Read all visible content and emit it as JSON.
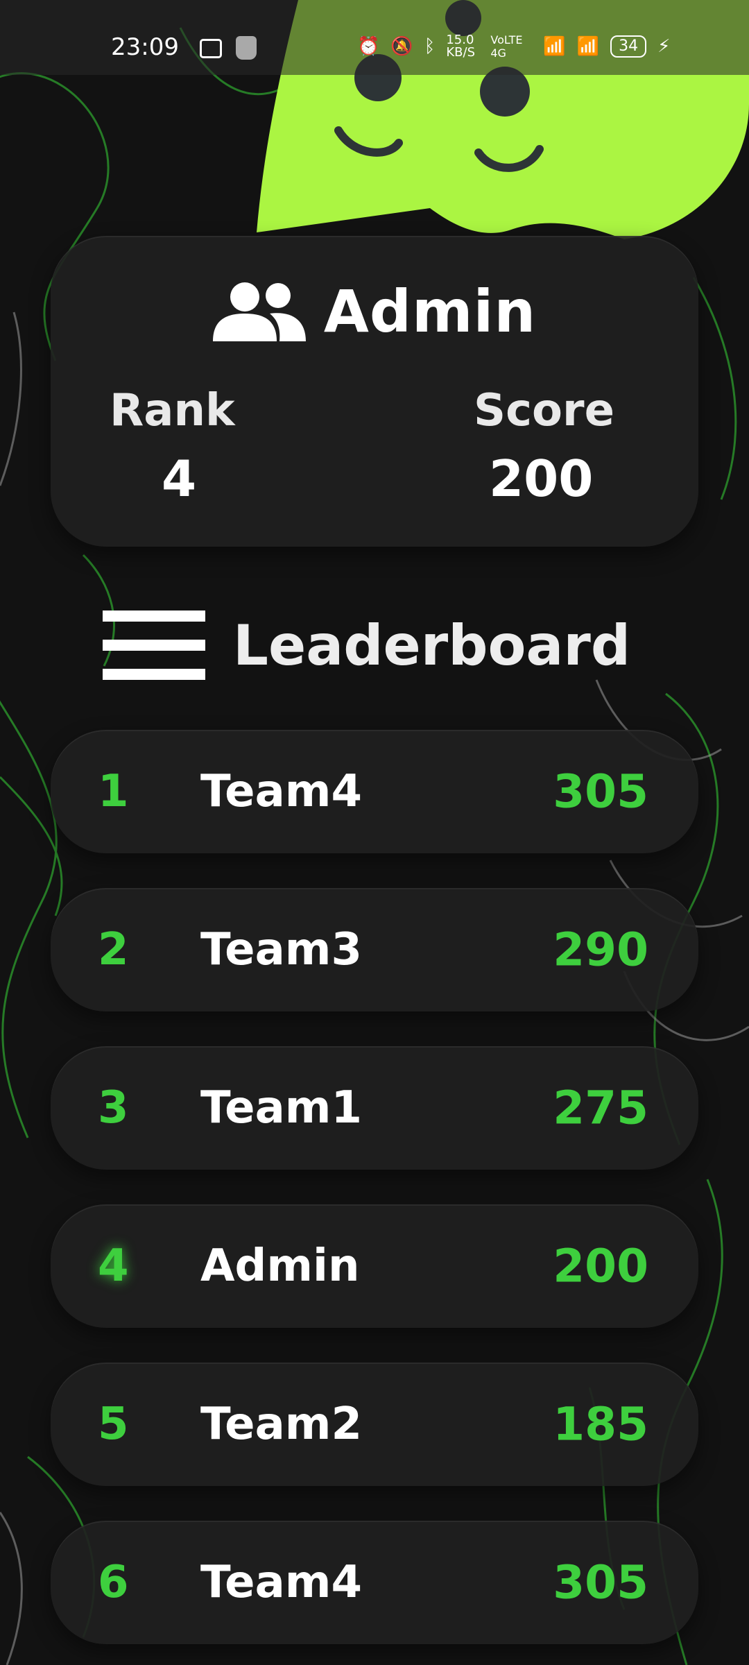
{
  "status_bar": {
    "time": "23:09",
    "net_speed": "15.0 KB/S",
    "network": "VoLTE 4G",
    "battery": "34"
  },
  "profile": {
    "name": "Admin",
    "rank_label": "Rank",
    "rank_value": "4",
    "score_label": "Score",
    "score_value": "200"
  },
  "leaderboard": {
    "title": "Leaderboard",
    "rows": [
      {
        "rank": "1",
        "team": "Team4",
        "score": "305"
      },
      {
        "rank": "2",
        "team": "Team3",
        "score": "290"
      },
      {
        "rank": "3",
        "team": "Team1",
        "score": "275"
      },
      {
        "rank": "4",
        "team": "Admin",
        "score": "200"
      },
      {
        "rank": "5",
        "team": "Team2",
        "score": "185"
      },
      {
        "rank": "6",
        "team": "Team4",
        "score": "305"
      }
    ]
  },
  "colors": {
    "accent_green": "#3ecf3e",
    "blob": "#abf542",
    "background": "#121212"
  }
}
